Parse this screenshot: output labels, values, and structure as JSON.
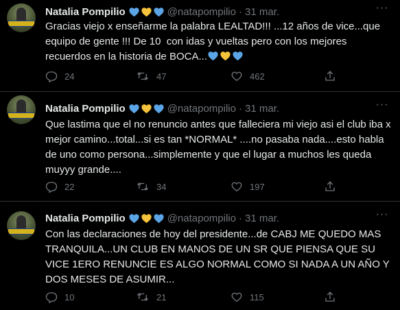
{
  "colors": {
    "background": "#000000",
    "text": "#e7e9ea",
    "muted": "#71767b",
    "divider": "#2f3336",
    "heart_blue": "#5ba4e5",
    "heart_yellow": "#f5c33b"
  },
  "tweets": [
    {
      "author": {
        "name": "Natalia Pompilio",
        "handle": "@natapompilio",
        "name_emojis": [
          "blue-heart-icon",
          "yellow-heart-icon",
          "blue-heart-icon"
        ]
      },
      "separator": "·",
      "date": "31 mar.",
      "more_icon": "more-dots-icon",
      "text": "Gracias viejo x enseñarme la palabra LEALTAD!!! ...12 años de vice...que equipo de gente !!! De 10  con idas y vueltas pero con los mejores recuerdos en la historia de BOCA...",
      "text_emojis": [
        "blue-heart-icon",
        "yellow-heart-icon",
        "blue-heart-icon"
      ],
      "replies": "24",
      "retweets": "47",
      "likes": "462"
    },
    {
      "author": {
        "name": "Natalia Pompilio",
        "handle": "@natapompilio",
        "name_emojis": [
          "blue-heart-icon",
          "yellow-heart-icon",
          "blue-heart-icon"
        ]
      },
      "separator": "·",
      "date": "31 mar.",
      "more_icon": "more-dots-icon",
      "text": "Que lastima que el no renuncio antes que falleciera mi viejo asi el club iba x mejor camino...total...si es tan *NORMAL* ....no pasaba nada....esto habla de uno como persona...simplemente y que el lugar a muchos les queda muyyy grande....",
      "text_emojis": [],
      "replies": "22",
      "retweets": "34",
      "likes": "197"
    },
    {
      "author": {
        "name": "Natalia Pompilio",
        "handle": "@natapompilio",
        "name_emojis": [
          "blue-heart-icon",
          "yellow-heart-icon",
          "blue-heart-icon"
        ]
      },
      "separator": "·",
      "date": "31 mar.",
      "more_icon": "more-dots-icon",
      "text": "Con las declaraciones de hoy del presidente...de CABJ ME QUEDO MAS TRANQUILA...UN CLUB EN MANOS DE UN SR QUE PIENSA QUE SU VICE 1ERO RENUNCIE ES ALGO NORMAL COMO SI NADA A UN AÑO Y DOS MESES DE ASUMIR...",
      "text_emojis": [],
      "replies": "10",
      "retweets": "21",
      "likes": "115"
    }
  ],
  "action_icons": [
    "reply-icon",
    "retweet-icon",
    "like-icon",
    "share-icon"
  ]
}
